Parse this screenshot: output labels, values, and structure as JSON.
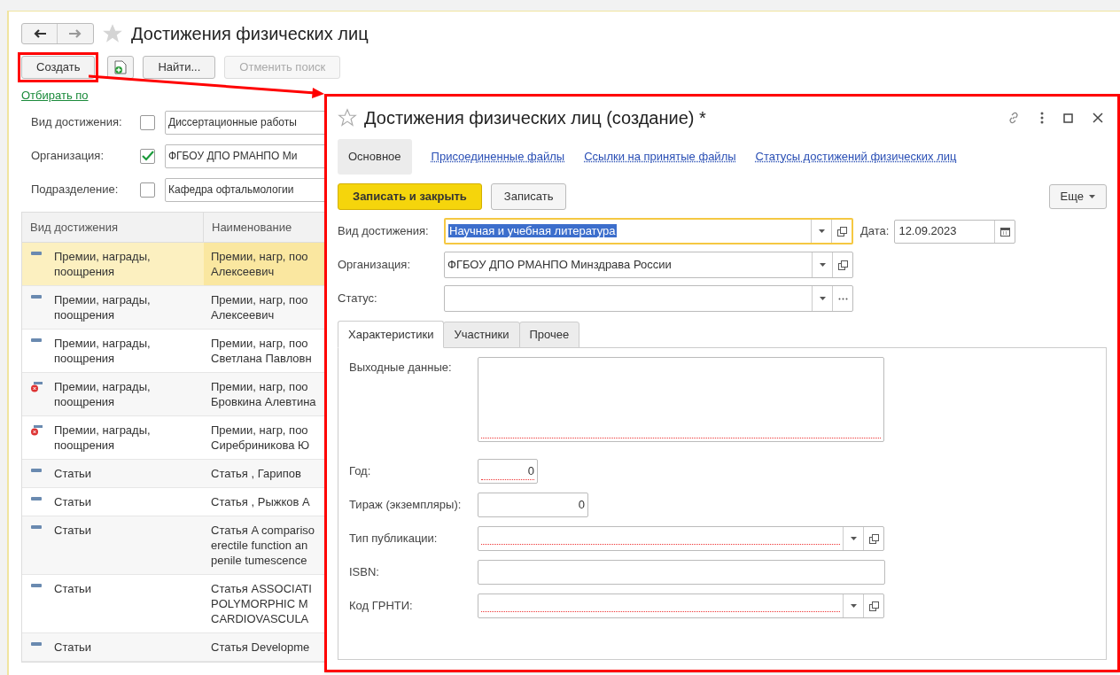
{
  "list_window": {
    "title": "Достижения физических лиц",
    "favorite": false,
    "toolbar": [
      {
        "kind": "text",
        "label": "Создать",
        "highlighted": true,
        "disabled": false
      },
      {
        "kind": "add-icon",
        "highlighted": false,
        "disabled": false
      },
      {
        "kind": "text",
        "label": "Найти...",
        "highlighted": false,
        "disabled": false
      },
      {
        "kind": "text",
        "label": "Отменить поиск",
        "highlighted": false,
        "disabled": true
      }
    ],
    "filter_link": "Отбирать по",
    "filters": [
      {
        "label": "Вид достижения:",
        "checked": false,
        "value": "Диссертационные работы"
      },
      {
        "label": "Организация:",
        "checked": true,
        "value": "ФГБОУ ДПО РМАНПО Ми"
      },
      {
        "label": "Подразделение:",
        "checked": false,
        "value": "Кафедра офтальмологии"
      }
    ],
    "table": {
      "columns": [
        "Вид достижения",
        "Наименование"
      ],
      "rows": [
        {
          "kind": "normal",
          "selected": true,
          "type": [
            "Премии, награды,",
            "поощрения"
          ],
          "name": [
            "Премии, нагр, поо",
            "Алексеевич"
          ]
        },
        {
          "kind": "normal",
          "selected": false,
          "type": [
            "Премии, награды,",
            "поощрения"
          ],
          "name": [
            "Премии, нагр, поо",
            "Алексеевич"
          ]
        },
        {
          "kind": "normal",
          "selected": false,
          "type": [
            "Премии, награды,",
            "поощрения"
          ],
          "name": [
            "Премии, нагр, поо",
            "Светлана Павловн"
          ]
        },
        {
          "kind": "deleted",
          "selected": false,
          "type": [
            "Премии, награды,",
            "поощрения"
          ],
          "name": [
            "Премии, нагр, поо",
            "Бровкина Алевтина"
          ]
        },
        {
          "kind": "deleted",
          "selected": false,
          "type": [
            "Премии, награды,",
            "поощрения"
          ],
          "name": [
            "Премии, нагр, поо",
            "Сиребриникова Ю"
          ]
        },
        {
          "kind": "normal",
          "selected": false,
          "type": [
            "Статьи"
          ],
          "name": [
            "Статья , Гарипов"
          ]
        },
        {
          "kind": "normal",
          "selected": false,
          "type": [
            "Статьи"
          ],
          "name": [
            "Статья , Рыжков А"
          ]
        },
        {
          "kind": "normal",
          "selected": false,
          "type": [
            "Статьи"
          ],
          "name": [
            "Статья A compariso",
            "erectile function an",
            "penile tumescence"
          ]
        },
        {
          "kind": "normal",
          "selected": false,
          "type": [
            "Статьи"
          ],
          "name": [
            "Статья ASSOCIATI",
            "POLYMORPHIC M",
            "CARDIOVASCULA"
          ]
        },
        {
          "kind": "normal",
          "selected": false,
          "type": [
            "Статьи"
          ],
          "name": [
            "Статья Developme"
          ]
        }
      ]
    }
  },
  "dialog": {
    "title": "Достижения физических лиц (создание) *",
    "favorite": false,
    "nav": [
      {
        "label": "Основное",
        "selected": true
      },
      {
        "label": "Присоединенные файлы",
        "selected": false
      },
      {
        "label": "Ссылки на принятые файлы",
        "selected": false
      },
      {
        "label": "Статусы достижений физических лиц",
        "selected": false
      }
    ],
    "buttons": [
      {
        "label": "Записать и закрыть",
        "kind": "primary"
      },
      {
        "label": "Записать",
        "kind": "normal"
      }
    ],
    "more": "Еще",
    "fields": [
      {
        "label": "Вид достижения:",
        "value": "Научная и учебная литература",
        "focused": true,
        "kind": "reference"
      },
      {
        "label": "Организация:",
        "value": "ФГБОУ ДПО РМАНПО Минздрава России",
        "focused": false,
        "kind": "reference"
      },
      {
        "label": "Статус:",
        "focused": false,
        "kind": "choice"
      }
    ],
    "date_label": "Дата:",
    "date": "12.09.2023",
    "tabs": [
      {
        "label": "Характеристики",
        "selected": true
      },
      {
        "label": "Участники",
        "selected": false
      },
      {
        "label": "Прочее",
        "selected": false
      }
    ],
    "props": [
      {
        "kind": "textarea",
        "label": "Выходные данные:",
        "required": true
      },
      {
        "kind": "number",
        "label": "Год:",
        "value": "0",
        "required": true
      },
      {
        "kind": "number",
        "label": "Тираж (экземпляры):",
        "value": "0",
        "required": false
      },
      {
        "kind": "select",
        "label": "Тип публикации:",
        "required": true
      },
      {
        "kind": "text",
        "label": "ISBN:",
        "required": false
      },
      {
        "kind": "select",
        "label": "Код ГРНТИ:",
        "required": true
      }
    ]
  }
}
